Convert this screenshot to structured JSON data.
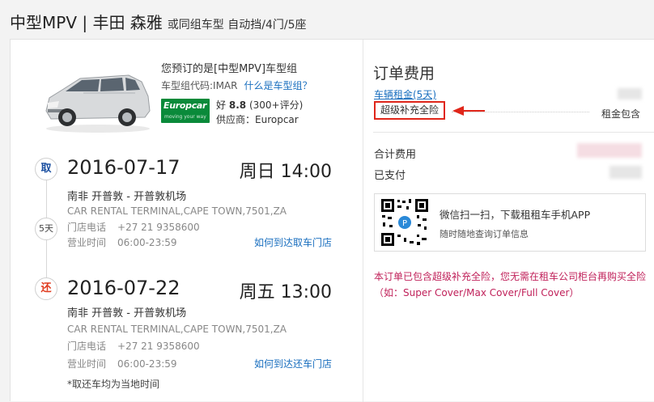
{
  "header": {
    "title": "中型MPV | 丰田 森雅",
    "subtitle": "或同组车型 自动挡/4门/5座"
  },
  "car": {
    "title": "您预订的是[中型MPV]车型组",
    "code_label": "车型组代码:IMAR",
    "what_link": "什么是车型组？",
    "vendor_logo_l1": "Europcar",
    "vendor_logo_l2": "moving your way",
    "rating_label": "好",
    "rating_score": "8.8",
    "rating_count": "(300+评分)",
    "supplier": "供应商：Europcar"
  },
  "pickup": {
    "badge": "取",
    "date": "2016-07-17",
    "time": "周日 14:00",
    "location": "南非 开普敦 - 开普敦机场",
    "address": "CAR RENTAL TERMINAL,CAPE TOWN,7501,ZA",
    "phone_label": "门店电话",
    "phone": "+27 21 9358600",
    "hours_label": "营业时间",
    "hours": "06:00-23:59",
    "link": "如何到达取车门店"
  },
  "duration": "5天",
  "return": {
    "badge": "还",
    "date": "2016-07-22",
    "time": "周五 13:00",
    "location": "南非 开普敦 - 开普敦机场",
    "address": "CAR RENTAL TERMINAL,CAPE TOWN,7501,ZA",
    "phone_label": "门店电话",
    "phone": "+27 21 9358600",
    "hours_label": "营业时间",
    "hours": "06:00-23:59",
    "link": "如何到达还车门店"
  },
  "footnote": "*取还车均为当地时间",
  "fees": {
    "title": "订单费用",
    "rent_label": "车辆租金(5天)",
    "insurance": "超级补充全险",
    "insurance_note": "租金包含",
    "total_label": "合计费用",
    "paid_label": "已支付"
  },
  "app": {
    "line1": "微信扫一扫，下载租租车手机APP",
    "line2": "随时随地查询订单信息"
  },
  "notice": "本订单已包含超级补充全险，您无需在租车公司柜台再购买全险（如：Super Cover/Max Cover/Full Cover）",
  "colors": {
    "link": "#1a6fbf",
    "highlight": "#e0261a",
    "notice": "#c0215a",
    "vendor": "#0a8a3a"
  }
}
